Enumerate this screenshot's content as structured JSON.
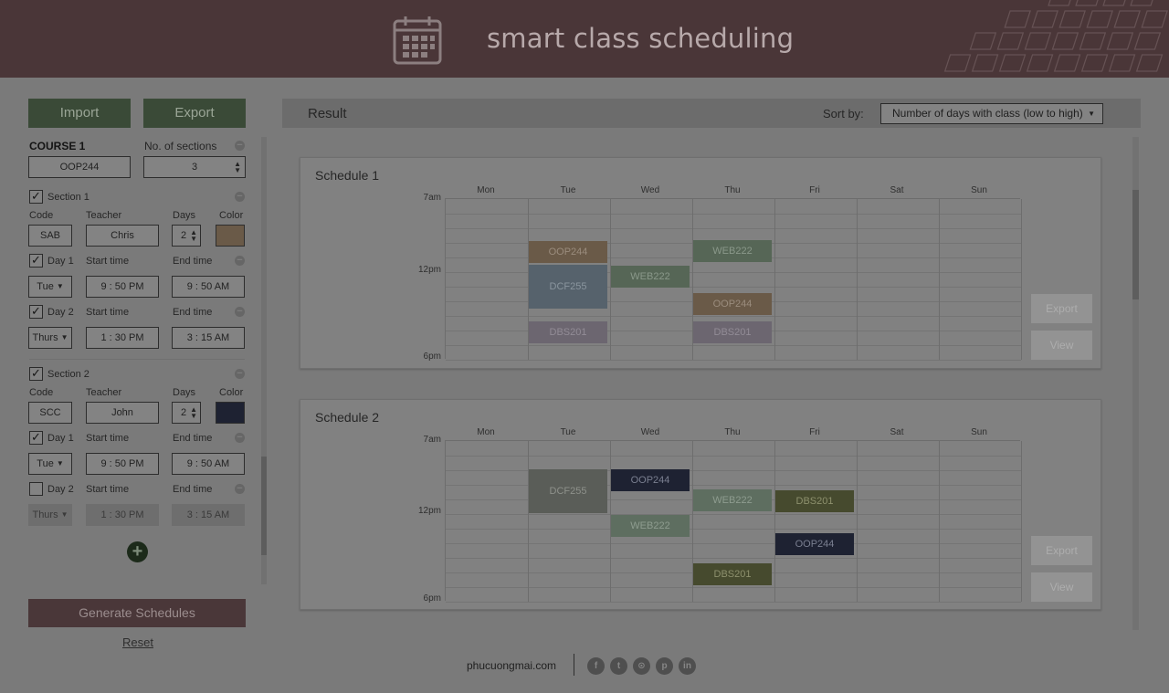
{
  "header": {
    "title": "smart class scheduling"
  },
  "sidebar": {
    "import_label": "Import",
    "export_label": "Export",
    "course": {
      "label": "COURSE 1",
      "sections_label": "No. of sections",
      "code": "OOP244",
      "sections": "3"
    },
    "section1": {
      "label": "Section 1",
      "code_label": "Code",
      "teacher_label": "Teacher",
      "days_label": "Days",
      "color_label": "Color",
      "code": "SAB",
      "teacher": "Chris",
      "days": "2",
      "color": "#6a5a48",
      "day1": {
        "label": "Day 1",
        "start_label": "Start time",
        "end_label": "End time",
        "day": "Tue",
        "start": "9 : 50 PM",
        "end": "9 : 50 AM"
      },
      "day2": {
        "label": "Day 2",
        "start_label": "Start time",
        "end_label": "End time",
        "day": "Thurs",
        "start": "1 : 30 PM",
        "end": "3 : 15 AM"
      }
    },
    "section2": {
      "label": "Section 2",
      "code_label": "Code",
      "teacher_label": "Teacher",
      "days_label": "Days",
      "color_label": "Color",
      "code": "SCC",
      "teacher": "John",
      "days": "2",
      "color": "#1e2232",
      "day1": {
        "label": "Day 1",
        "start_label": "Start time",
        "end_label": "End time",
        "day": "Tue",
        "start": "9 : 50 PM",
        "end": "9 : 50 AM"
      },
      "day2": {
        "label": "Day 2",
        "start_label": "Start time",
        "end_label": "End time",
        "day": "Thurs",
        "start": "1 : 30 PM",
        "end": "3 : 15 AM"
      }
    },
    "generate_label": "Generate Schedules",
    "reset_label": "Reset"
  },
  "result": {
    "title": "Result",
    "sort_label": "Sort by:",
    "sort_value": "Number of days with class (low to high)",
    "days": [
      "Mon",
      "Tue",
      "Wed",
      "Thu",
      "Fri",
      "Sat",
      "Sun"
    ],
    "time_labels": [
      "7am",
      "12pm",
      "6pm"
    ],
    "export_label": "Export",
    "view_label": "View",
    "schedules": [
      {
        "title": "Schedule 1",
        "events": [
          {
            "course": "OOP244",
            "day": "Tue",
            "color": "#6a5a48",
            "text_color": "#9a8c7d"
          },
          {
            "course": "DCF255",
            "day": "Tue",
            "color": "#56626c",
            "text_color": "#8a959e"
          },
          {
            "course": "DBS201",
            "day": "Tue",
            "color": "#6c6670",
            "text_color": "#928c96"
          },
          {
            "course": "WEB222",
            "day": "Wed",
            "color": "#566656",
            "text_color": "#8a988a"
          },
          {
            "course": "WEB222",
            "day": "Thu",
            "color": "#566656",
            "text_color": "#8a988a"
          },
          {
            "course": "OOP244",
            "day": "Thu",
            "color": "#6a5a48",
            "text_color": "#9a8c7d"
          },
          {
            "course": "DBS201",
            "day": "Thu",
            "color": "#6c6670",
            "text_color": "#928c96"
          }
        ]
      },
      {
        "title": "Schedule 2",
        "events": [
          {
            "course": "DCF255",
            "day": "Tue",
            "color": "#5a5d58",
            "text_color": "#8e918b"
          },
          {
            "course": "OOP244",
            "day": "Wed",
            "color": "#1e2232",
            "text_color": "#7a7f90"
          },
          {
            "course": "WEB222",
            "day": "Wed",
            "color": "#5e6e60",
            "text_color": "#8e9c8f"
          },
          {
            "course": "WEB222",
            "day": "Thu",
            "color": "#5e6e60",
            "text_color": "#8e9c8f"
          },
          {
            "course": "DBS201",
            "day": "Thu",
            "color": "#464a2e",
            "text_color": "#8d906d"
          },
          {
            "course": "DBS201",
            "day": "Fri",
            "color": "#464a2e",
            "text_color": "#8d906d"
          },
          {
            "course": "OOP244",
            "day": "Fri",
            "color": "#1e2232",
            "text_color": "#7a7f90"
          }
        ]
      }
    ]
  },
  "footer": {
    "site": "phucuongmai.com",
    "social": [
      "facebook-icon",
      "twitter-icon",
      "github-icon",
      "pinterest-icon",
      "linkedin-icon"
    ]
  }
}
